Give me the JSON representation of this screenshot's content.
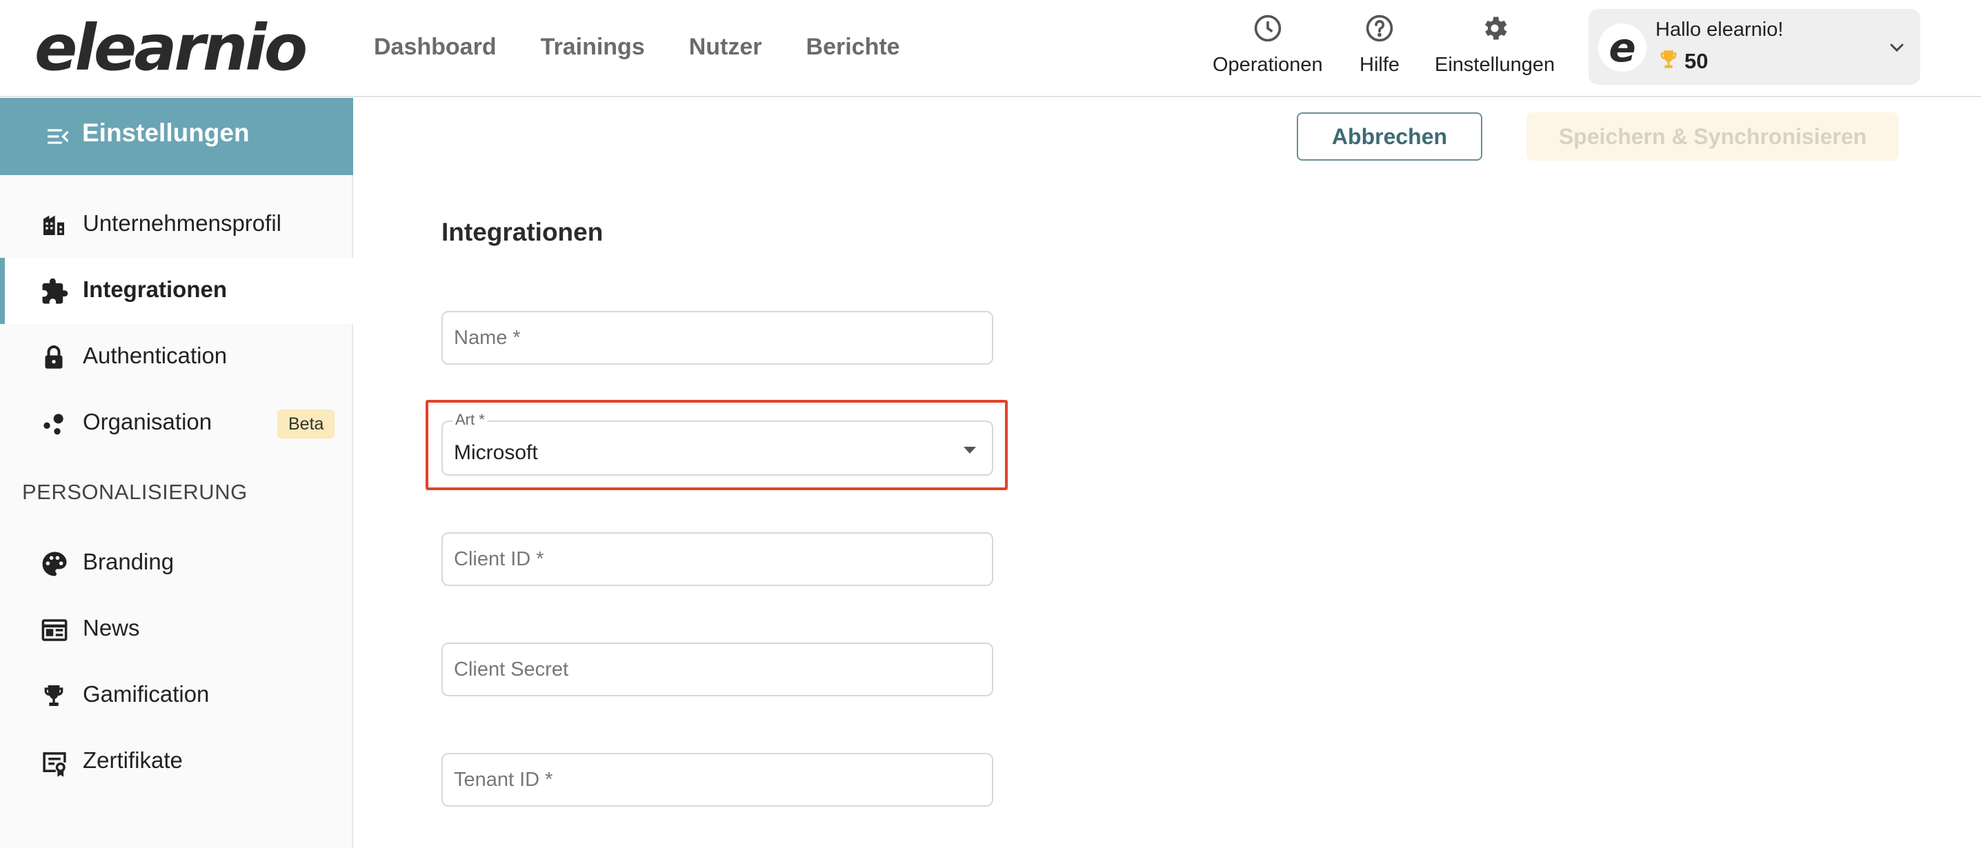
{
  "app": {
    "logo": "elearnio"
  },
  "nav": {
    "items": [
      {
        "label": "Dashboard"
      },
      {
        "label": "Trainings"
      },
      {
        "label": "Nutzer"
      },
      {
        "label": "Berichte"
      }
    ]
  },
  "utility": {
    "operations": {
      "label": "Operationen",
      "icon": "clock-icon"
    },
    "help": {
      "label": "Hilfe",
      "icon": "help-circle-icon"
    },
    "settings": {
      "label": "Einstellungen",
      "icon": "gear-icon"
    }
  },
  "user": {
    "avatar_letter": "e",
    "greeting": "Hallo elearnio!",
    "points": "50",
    "points_icon": "trophy-icon",
    "points_color": "#f5b52e"
  },
  "sidebar": {
    "header": "Einstellungen",
    "items": [
      {
        "label": "Unternehmensprofil",
        "icon": "building-icon"
      },
      {
        "label": "Integrationen",
        "icon": "puzzle-icon",
        "active": true
      },
      {
        "label": "Authentication",
        "icon": "lock-icon"
      },
      {
        "label": "Organisation",
        "icon": "organisation-icon",
        "badge": "Beta"
      }
    ],
    "section_label": "PERSONALISIERUNG",
    "personal_items": [
      {
        "label": "Branding",
        "icon": "palette-icon"
      },
      {
        "label": "News",
        "icon": "newspaper-icon"
      },
      {
        "label": "Gamification",
        "icon": "trophy-icon"
      },
      {
        "label": "Zertifikate",
        "icon": "certificate-icon"
      }
    ],
    "accent_color": "#6aa5b4"
  },
  "actions": {
    "cancel_label": "Abbrechen",
    "save_label": "Speichern & Synchronisieren"
  },
  "form": {
    "title": "Integrationen",
    "name_placeholder": "Name *",
    "type_label": "Art *",
    "type_value": "Microsoft",
    "client_id_placeholder": "Client ID *",
    "client_secret_placeholder": "Client Secret",
    "tenant_id_placeholder": "Tenant ID *"
  },
  "highlight_color": "#e0432a"
}
